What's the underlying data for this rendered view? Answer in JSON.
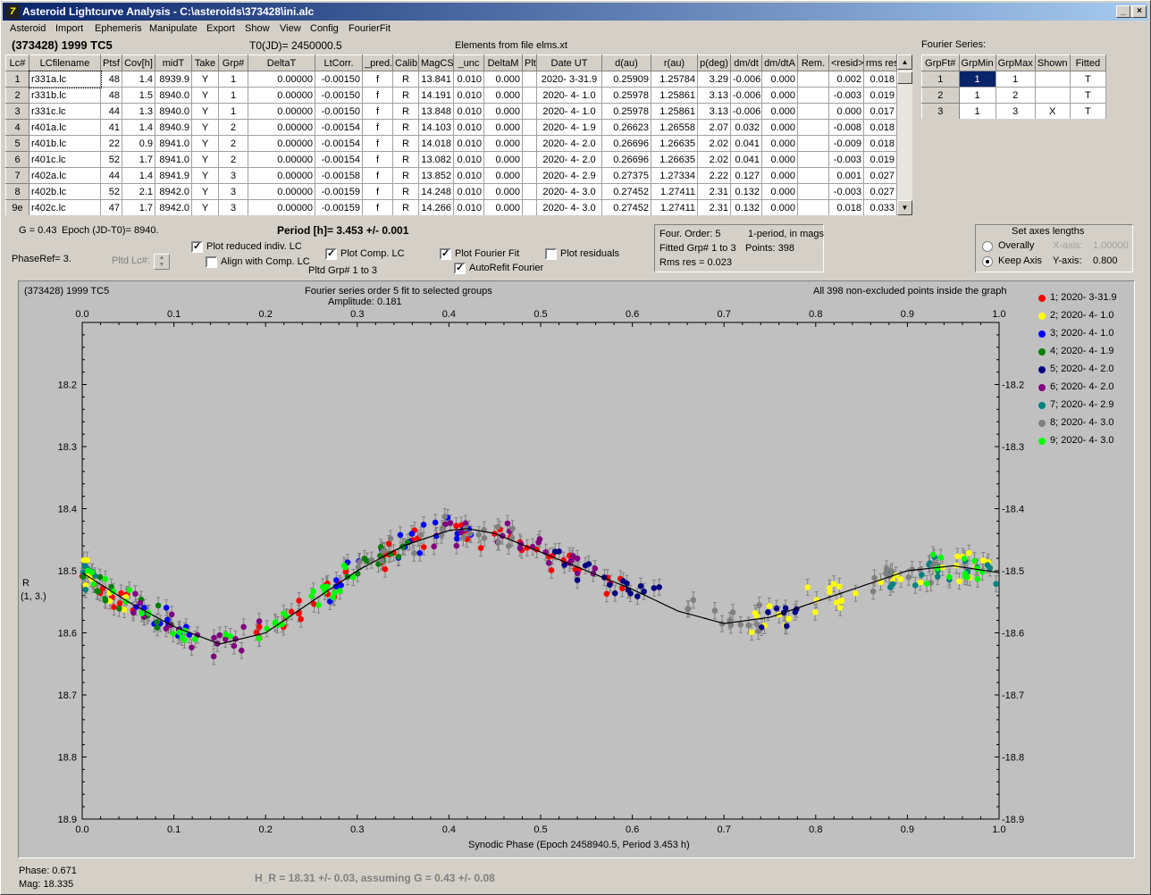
{
  "window": {
    "title": "Asteroid Lightcurve Analysis - C:\\asteroids\\373428\\ini.alc",
    "icon_glyph": "7"
  },
  "menu": [
    "Asteroid",
    "Import",
    "Ephemeris",
    "Manipulate",
    "Export",
    "Show",
    "View",
    "Config",
    "FourierFit"
  ],
  "header": {
    "object": "(373428) 1999 TC5",
    "t0": "T0(JD)= 2450000.5",
    "elements": "Elements from file elms.xt"
  },
  "lc_table": {
    "columns": [
      "Lc#",
      "LCfilename",
      "Ptsf",
      "Cov[h]",
      "midT",
      "Take",
      "Grp#",
      "DeltaT",
      "LtCorr.",
      "_pred.",
      "Calib",
      "MagCS",
      "_unc",
      "DeltaM",
      "Plt",
      "Date UT",
      "d(au)",
      "r(au)",
      "p(deg)",
      "dm/dt",
      "dm/dtA",
      "Rem.",
      "<resid>",
      "rms res"
    ],
    "rows": [
      [
        "1",
        "r331a.lc",
        "48",
        "1.4",
        "8939.9",
        "Y",
        "1",
        "0.00000",
        "-0.00150",
        "f",
        "R",
        "13.841",
        "0.010",
        "0.000",
        "",
        "2020- 3-31.9",
        "0.25909",
        "1.25784",
        "3.29",
        "-0.006",
        "0.000",
        "",
        "0.002",
        "0.018"
      ],
      [
        "2",
        "r331b.lc",
        "48",
        "1.5",
        "8940.0",
        "Y",
        "1",
        "0.00000",
        "-0.00150",
        "f",
        "R",
        "14.191",
        "0.010",
        "0.000",
        "",
        "2020- 4- 1.0",
        "0.25978",
        "1.25861",
        "3.13",
        "-0.006",
        "0.000",
        "",
        "-0.003",
        "0.019"
      ],
      [
        "3",
        "r331c.lc",
        "44",
        "1.3",
        "8940.0",
        "Y",
        "1",
        "0.00000",
        "-0.00150",
        "f",
        "R",
        "13.848",
        "0.010",
        "0.000",
        "",
        "2020- 4- 1.0",
        "0.25978",
        "1.25861",
        "3.13",
        "-0.006",
        "0.000",
        "",
        "0.000",
        "0.017"
      ],
      [
        "4",
        "r401a.lc",
        "41",
        "1.4",
        "8940.9",
        "Y",
        "2",
        "0.00000",
        "-0.00154",
        "f",
        "R",
        "14.103",
        "0.010",
        "0.000",
        "",
        "2020- 4- 1.9",
        "0.26623",
        "1.26558",
        "2.07",
        "0.032",
        "0.000",
        "",
        "-0.008",
        "0.018"
      ],
      [
        "5",
        "r401b.lc",
        "22",
        "0.9",
        "8941.0",
        "Y",
        "2",
        "0.00000",
        "-0.00154",
        "f",
        "R",
        "14.018",
        "0.010",
        "0.000",
        "",
        "2020- 4- 2.0",
        "0.26696",
        "1.26635",
        "2.02",
        "0.041",
        "0.000",
        "",
        "-0.009",
        "0.018"
      ],
      [
        "6",
        "r401c.lc",
        "52",
        "1.7",
        "8941.0",
        "Y",
        "2",
        "0.00000",
        "-0.00154",
        "f",
        "R",
        "13.082",
        "0.010",
        "0.000",
        "",
        "2020- 4- 2.0",
        "0.26696",
        "1.26635",
        "2.02",
        "0.041",
        "0.000",
        "",
        "-0.003",
        "0.019"
      ],
      [
        "7",
        "r402a.lc",
        "44",
        "1.4",
        "8941.9",
        "Y",
        "3",
        "0.00000",
        "-0.00158",
        "f",
        "R",
        "13.852",
        "0.010",
        "0.000",
        "",
        "2020- 4- 2.9",
        "0.27375",
        "1.27334",
        "2.22",
        "0.127",
        "0.000",
        "",
        "0.001",
        "0.027"
      ],
      [
        "8",
        "r402b.lc",
        "52",
        "2.1",
        "8942.0",
        "Y",
        "3",
        "0.00000",
        "-0.00159",
        "f",
        "R",
        "14.248",
        "0.010",
        "0.000",
        "",
        "2020- 4- 3.0",
        "0.27452",
        "1.27411",
        "2.31",
        "0.132",
        "0.000",
        "",
        "-0.003",
        "0.027"
      ],
      [
        "9e",
        "r402c.lc",
        "47",
        "1.7",
        "8942.0",
        "Y",
        "3",
        "0.00000",
        "-0.00159",
        "f",
        "R",
        "14.266",
        "0.010",
        "0.000",
        "",
        "2020- 4- 3.0",
        "0.27452",
        "1.27411",
        "2.31",
        "0.132",
        "0.000",
        "",
        "0.018",
        "0.033"
      ]
    ]
  },
  "fourier_table": {
    "title": "Fourier Series:",
    "columns": [
      "GrpFt#",
      "GrpMin",
      "GrpMax",
      "Shown",
      "Fitted"
    ],
    "rows": [
      [
        "1",
        "1",
        "1",
        "",
        "T"
      ],
      [
        "2",
        "1",
        "2",
        "",
        "T"
      ],
      [
        "3",
        "1",
        "3",
        "X",
        "T"
      ]
    ]
  },
  "controls": {
    "g_label": "G = 0.43",
    "epoch_label": "Epoch (JD-T0)= 8940.",
    "period": "Period [h]= 3.453 +/- 0.001",
    "phaseref": "PhaseRef= 3.",
    "pltd_lc": "Pltd Lc#:",
    "plot_reduced": "Plot reduced indiv. LC",
    "align_comp": "Align with Comp. LC",
    "plot_comp": "Plot Comp. LC",
    "pltd_grp": "Pltd Grp#  1   to   3",
    "plot_fourier": "Plot Fourier Fit",
    "autorefit": "AutoRefit Fourier",
    "plot_residuals": "Plot residuals"
  },
  "fourier_info": {
    "order": "Four. Order:  5",
    "period_mode": "1-period, in mags",
    "fitted": "Fitted Grp# 1 to 3",
    "points": "Points: 398",
    "rms": "Rms res      = 0.023"
  },
  "axes_box": {
    "title": "Set axes lengths",
    "overally": "Overally",
    "keep_axis": "Keep Axis",
    "xaxis_label": "X-axis:",
    "xaxis_value": "1.00000",
    "yaxis_label": "Y-axis:",
    "yaxis_value": "0.800",
    "selected": "Keep Axis"
  },
  "plot": {
    "left_title": "(373428) 1999 TC5",
    "center_title": "Fourier series order 5 fit to selected groups",
    "amplitude": "Amplitude: 0.181",
    "right_title": "All 398 non-excluded points inside the graph",
    "ylabel_1": "R",
    "ylabel_2": "(1, 3.)",
    "xlabel": "Synodic Phase (Epoch 2458940.5, Period 3.453 h)"
  },
  "chart_data": {
    "type": "scatter",
    "xlim": [
      0,
      1
    ],
    "ylim": [
      18.9,
      18.1
    ],
    "inverted_y": true,
    "xticks": [
      "0.0",
      "0.1",
      "0.2",
      "0.3",
      "0.4",
      "0.5",
      "0.6",
      "0.7",
      "0.8",
      "0.9",
      "1.0"
    ],
    "yticks": [
      "18.2",
      "18.3",
      "18.4",
      "18.5",
      "18.6",
      "18.7",
      "18.8",
      "18.9"
    ],
    "series": [
      {
        "name": "1; 2020- 3-31.9",
        "color": "#ff0000",
        "ranges": [
          [
            0.0,
            0.06
          ],
          [
            0.18,
            0.35
          ],
          [
            0.36,
            0.6
          ]
        ]
      },
      {
        "name": "2; 2020- 4- 1.0",
        "color": "#ffff00",
        "ranges": [
          [
            0.0,
            0.05
          ],
          [
            0.7,
            0.99
          ]
        ]
      },
      {
        "name": "3; 2020- 4- 1.0",
        "color": "#0000ff",
        "ranges": [
          [
            0.05,
            0.12
          ],
          [
            0.27,
            0.43
          ]
        ]
      },
      {
        "name": "4; 2020- 4- 1.9",
        "color": "#008000",
        "ranges": [
          [
            0.0,
            0.1
          ],
          [
            0.28,
            0.36
          ]
        ]
      },
      {
        "name": "5; 2020- 4- 2.0",
        "color": "#000080",
        "ranges": [
          [
            0.5,
            0.63
          ],
          [
            0.74,
            0.78
          ]
        ]
      },
      {
        "name": "6; 2020- 4- 2.0",
        "color": "#800080",
        "ranges": [
          [
            0.05,
            0.2
          ],
          [
            0.38,
            0.56
          ]
        ]
      },
      {
        "name": "7; 2020- 4- 2.9",
        "color": "#008080",
        "ranges": [
          [
            0.88,
            1.0
          ],
          [
            0.0,
            0.02
          ]
        ]
      },
      {
        "name": "8; 2020- 4- 3.0",
        "color": "#808080",
        "ranges": [
          [
            0.3,
            0.48
          ],
          [
            0.66,
            0.74
          ],
          [
            0.86,
            0.94
          ]
        ]
      },
      {
        "name": "9; 2020- 4- 3.0",
        "color": "#00ff00",
        "ranges": [
          [
            0.0,
            0.3
          ],
          [
            0.92,
            1.0
          ]
        ]
      }
    ],
    "fit_curve": [
      [
        0.0,
        18.503
      ],
      [
        0.05,
        18.55
      ],
      [
        0.1,
        18.59
      ],
      [
        0.15,
        18.618
      ],
      [
        0.2,
        18.6
      ],
      [
        0.25,
        18.55
      ],
      [
        0.3,
        18.5
      ],
      [
        0.35,
        18.46
      ],
      [
        0.4,
        18.435
      ],
      [
        0.42,
        18.432
      ],
      [
        0.45,
        18.44
      ],
      [
        0.5,
        18.47
      ],
      [
        0.55,
        18.5
      ],
      [
        0.6,
        18.53
      ],
      [
        0.65,
        18.565
      ],
      [
        0.7,
        18.585
      ],
      [
        0.75,
        18.575
      ],
      [
        0.8,
        18.55
      ],
      [
        0.85,
        18.525
      ],
      [
        0.9,
        18.5
      ],
      [
        0.95,
        18.492
      ],
      [
        1.0,
        18.503
      ]
    ]
  },
  "status": {
    "phase": "Phase:  0.671",
    "mag": "Mag:    18.335",
    "hr": "H_R = 18.31 +/- 0.03, assuming G = 0.43 +/- 0.08"
  }
}
